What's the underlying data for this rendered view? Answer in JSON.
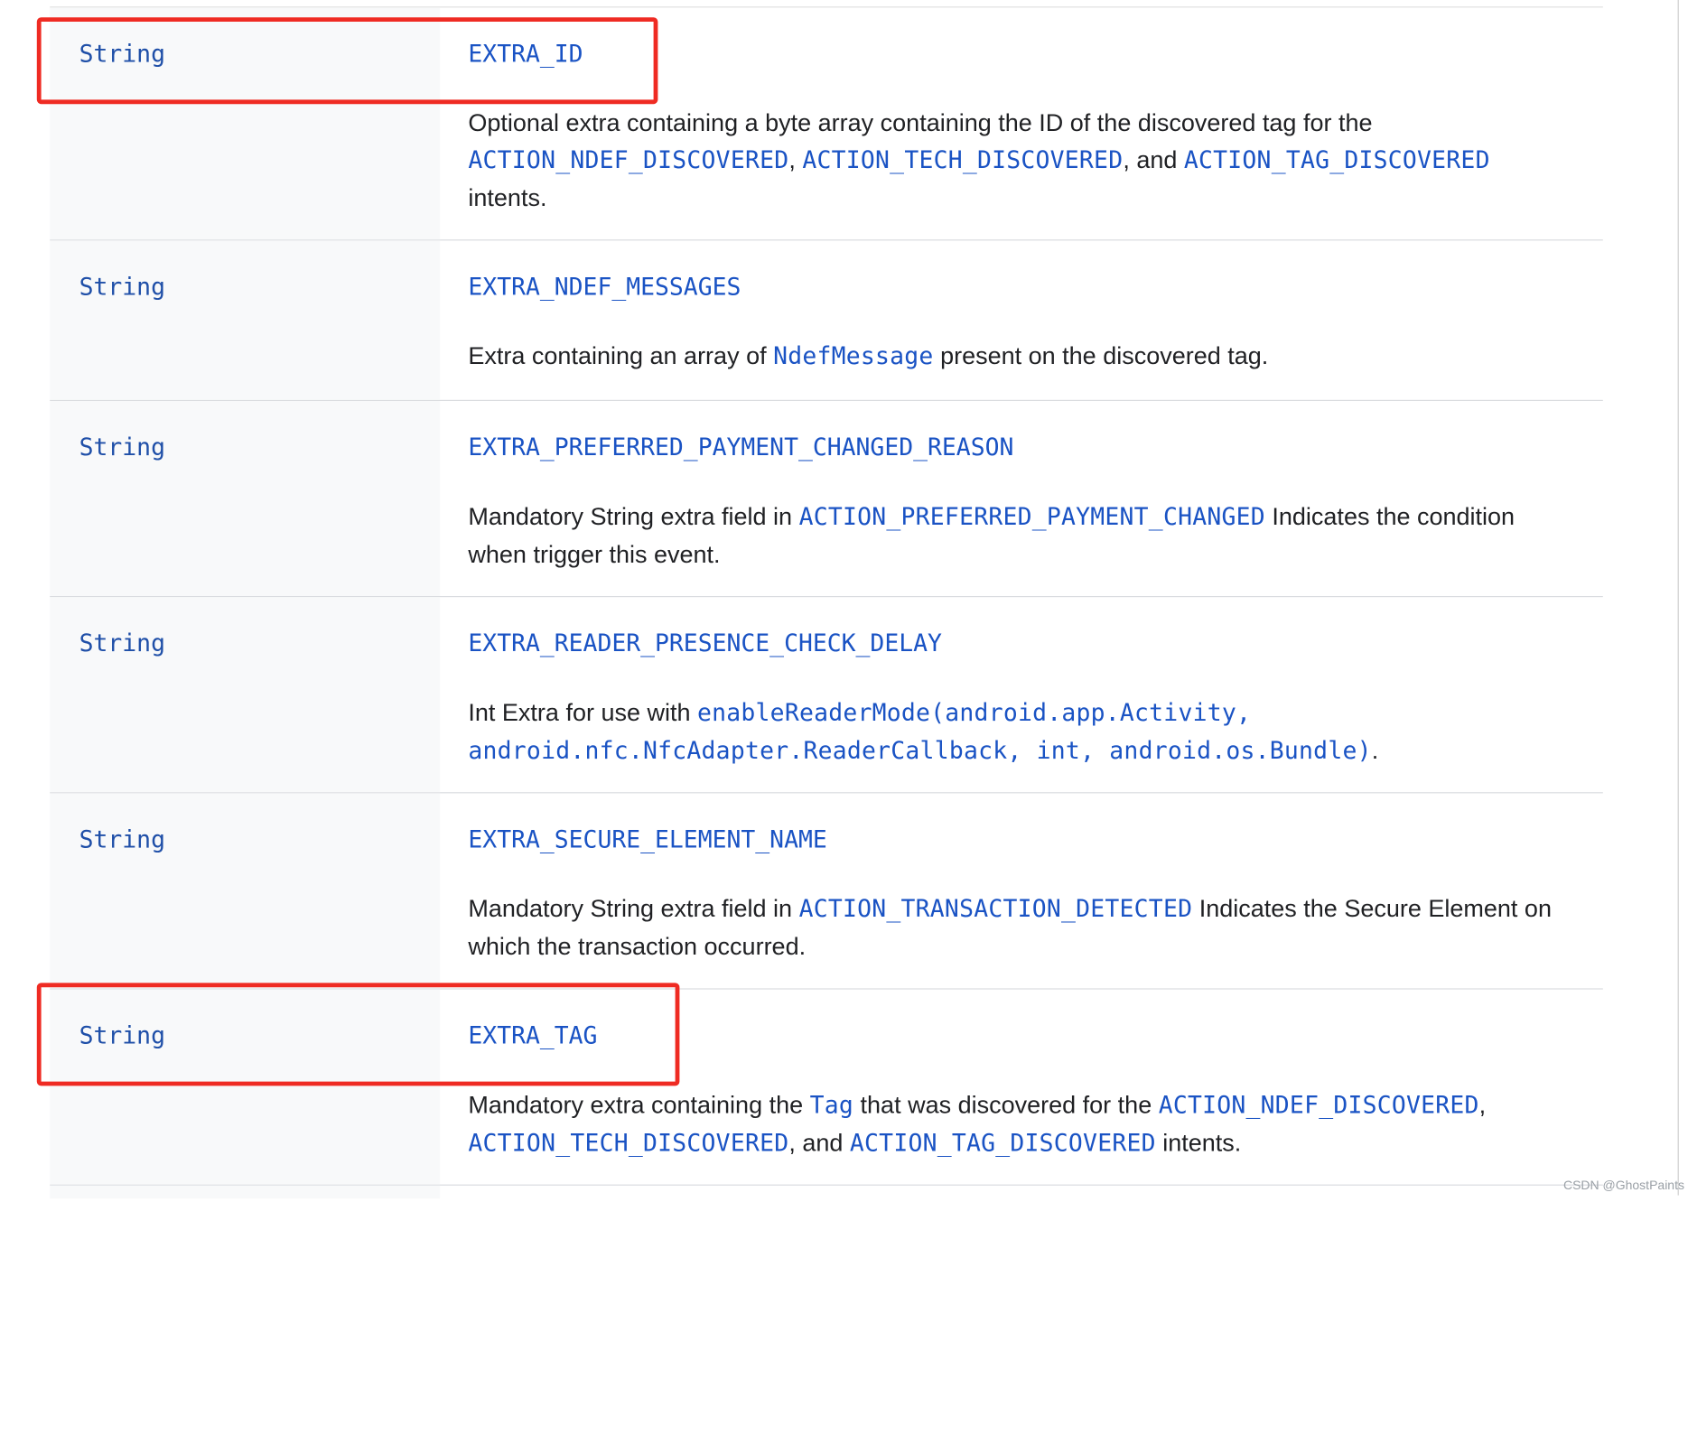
{
  "rows": [
    {
      "type": "String",
      "name": "EXTRA_ID",
      "desc": [
        {
          "t": "Optional extra containing a byte array containing the ID of the discovered tag for the ",
          "code": false
        },
        {
          "t": "ACTION_NDEF_DISCOVERED",
          "code": true
        },
        {
          "t": ", ",
          "code": false
        },
        {
          "t": "ACTION_TECH_DISCOVERED",
          "code": true
        },
        {
          "t": ", and ",
          "code": false
        },
        {
          "t": "ACTION_TAG_DISCOVERED",
          "code": true
        },
        {
          "t": " intents.",
          "code": false
        }
      ]
    },
    {
      "type": "String",
      "name": "EXTRA_NDEF_MESSAGES",
      "desc": [
        {
          "t": "Extra containing an array of ",
          "code": false
        },
        {
          "t": "NdefMessage",
          "code": true
        },
        {
          "t": " present on the discovered tag.",
          "code": false
        }
      ]
    },
    {
      "type": "String",
      "name": "EXTRA_PREFERRED_PAYMENT_CHANGED_REASON",
      "desc": [
        {
          "t": "Mandatory String extra field in ",
          "code": false
        },
        {
          "t": "ACTION_PREFERRED_PAYMENT_CHANGED",
          "code": true
        },
        {
          "t": " Indicates the condition when trigger this event.",
          "code": false
        }
      ]
    },
    {
      "type": "String",
      "name": "EXTRA_READER_PRESENCE_CHECK_DELAY",
      "desc": [
        {
          "t": "Int Extra for use with ",
          "code": false
        },
        {
          "t": "enableReaderMode(android.app.Activity, android.nfc.NfcAdapter.ReaderCallback, int, android.os.Bundle)",
          "code": true
        },
        {
          "t": ".",
          "code": false
        }
      ]
    },
    {
      "type": "String",
      "name": "EXTRA_SECURE_ELEMENT_NAME",
      "desc": [
        {
          "t": "Mandatory String extra field in ",
          "code": false
        },
        {
          "t": "ACTION_TRANSACTION_DETECTED",
          "code": true
        },
        {
          "t": " Indicates the Secure Element on which the transaction occurred.",
          "code": false
        }
      ]
    },
    {
      "type": "String",
      "name": "EXTRA_TAG",
      "desc": [
        {
          "t": "Mandatory extra containing the ",
          "code": false
        },
        {
          "t": "Tag",
          "code": true
        },
        {
          "t": " that was discovered for the ",
          "code": false
        },
        {
          "t": "ACTION_NDEF_DISCOVERED",
          "code": true
        },
        {
          "t": ", ",
          "code": false
        },
        {
          "t": "ACTION_TECH_DISCOVERED",
          "code": true
        },
        {
          "t": ", and ",
          "code": false
        },
        {
          "t": "ACTION_TAG_DISCOVERED",
          "code": true
        },
        {
          "t": " intents.",
          "code": false
        }
      ]
    }
  ],
  "highlight_color": "#ef2b23",
  "link_color": "#1a53c4",
  "watermark": "CSDN @GhostPaints"
}
